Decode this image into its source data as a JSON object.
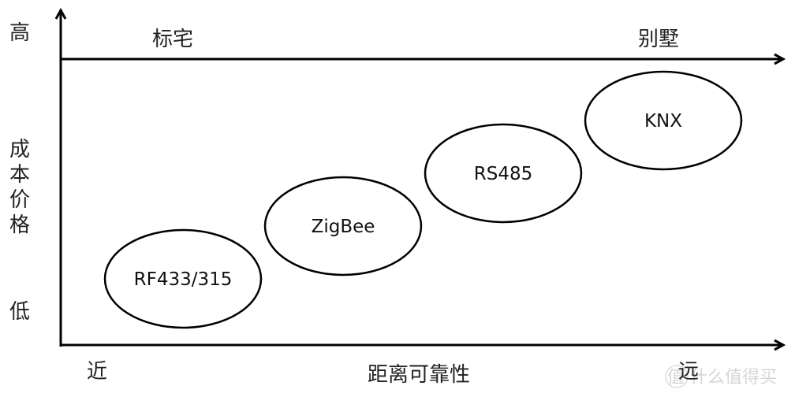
{
  "diagram": {
    "y_axis": {
      "label": "成本价格",
      "high": "高",
      "low": "低"
    },
    "x_axis": {
      "label": "距离可靠性",
      "near": "近",
      "far": "远"
    },
    "top_axis": {
      "left": "标宅",
      "right": "别墅"
    },
    "nodes": [
      {
        "label": "RF433/315",
        "distance_rank": 1,
        "cost_rank": 1
      },
      {
        "label": "ZigBee",
        "distance_rank": 2,
        "cost_rank": 2
      },
      {
        "label": "RS485",
        "distance_rank": 3,
        "cost_rank": 3
      },
      {
        "label": "KNX",
        "distance_rank": 4,
        "cost_rank": 4
      }
    ],
    "colors": {
      "line": "#000000",
      "text": "#222222",
      "watermark": "#d6d6d6"
    }
  },
  "watermark": {
    "icon_text": "值",
    "text": "什么值得买"
  }
}
